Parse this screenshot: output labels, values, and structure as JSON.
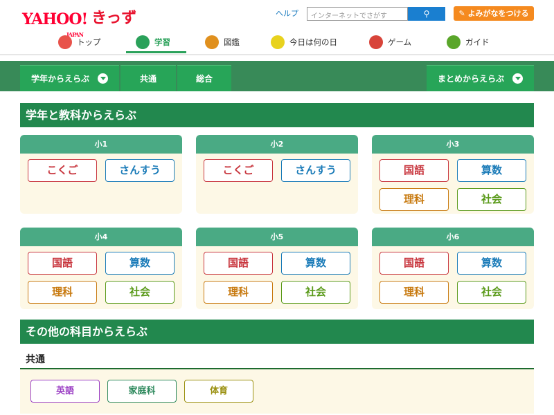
{
  "header": {
    "logo_text": "YAHOO! JAPAN きっず",
    "help": "ヘルプ",
    "search_placeholder": "インターネットでさがす",
    "yomigana_button": "よみがなをつける"
  },
  "nav": [
    {
      "label": "トップ",
      "icon": "house-icon",
      "color": "#e8524a"
    },
    {
      "label": "学習",
      "icon": "pencil-icon",
      "color": "#2aa15a",
      "active": true
    },
    {
      "label": "図鑑",
      "icon": "book-icon",
      "color": "#e0901e"
    },
    {
      "label": "今日は何の日",
      "icon": "calendar-icon",
      "color": "#e8d21e"
    },
    {
      "label": "ゲーム",
      "icon": "puzzle-icon",
      "color": "#d8443a"
    },
    {
      "label": "ガイド",
      "icon": "beginner-mark-icon",
      "color": "#5aa62a"
    }
  ],
  "tabs": {
    "grade": "学年からえらぶ",
    "common": "共通",
    "general": "総合",
    "summary": "まとめからえらぶ"
  },
  "section1": {
    "title": "学年と教科からえらぶ"
  },
  "grades": [
    {
      "name": "小1",
      "subjects": [
        "こくご",
        "さんすう"
      ]
    },
    {
      "name": "小2",
      "subjects": [
        "こくご",
        "さんすう"
      ]
    },
    {
      "name": "小3",
      "subjects": [
        "国語",
        "算数",
        "理科",
        "社会"
      ]
    },
    {
      "name": "小4",
      "subjects": [
        "国語",
        "算数",
        "理科",
        "社会"
      ]
    },
    {
      "name": "小5",
      "subjects": [
        "国語",
        "算数",
        "理科",
        "社会"
      ]
    },
    {
      "name": "小6",
      "subjects": [
        "国語",
        "算数",
        "理科",
        "社会"
      ]
    }
  ],
  "subject_colors": {
    "red": "#c8353d",
    "blue": "#1a7bb8",
    "orange": "#c87a10",
    "green": "#5a9a1a"
  },
  "section2": {
    "title": "その他の科目からえらぶ",
    "group": "共通",
    "subjects": [
      {
        "label": "英語",
        "color": "#9b3fc4"
      },
      {
        "label": "家庭科",
        "color": "#2f8a5e"
      },
      {
        "label": "体育",
        "color": "#9a9010"
      }
    ]
  }
}
